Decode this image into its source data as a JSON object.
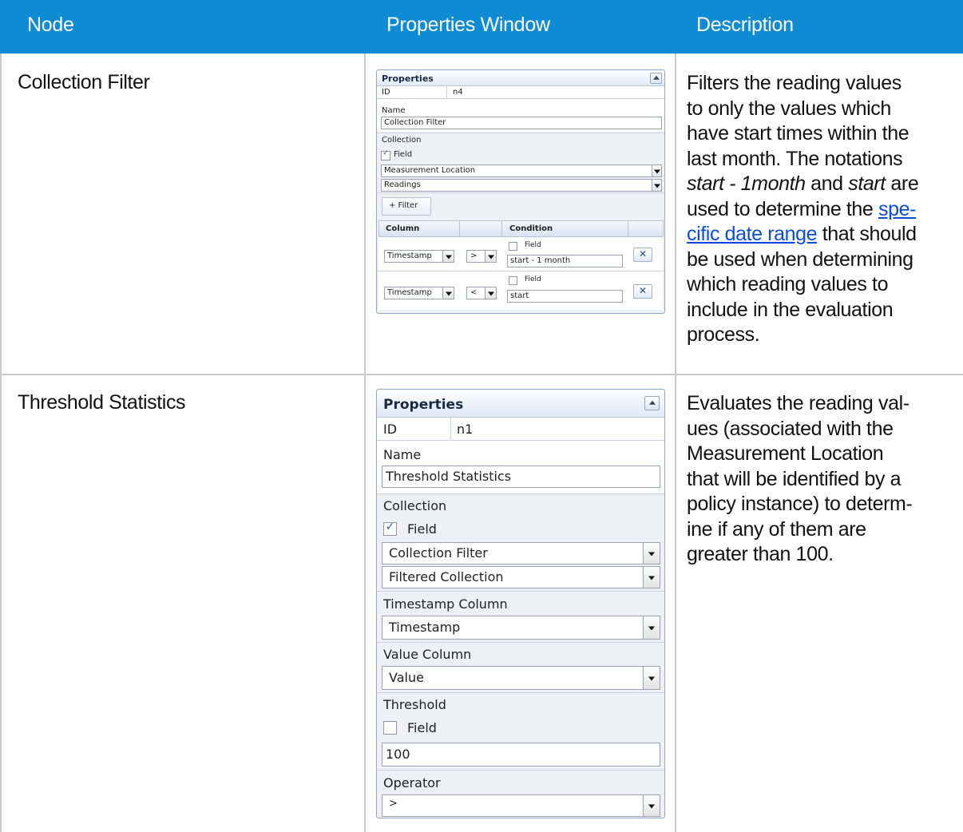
{
  "table": {
    "headers": {
      "node": "Node",
      "properties_window": "Properties Window",
      "description": "Description"
    },
    "header_bg": "#0f8bd4",
    "link_color": "#0a4dd8"
  },
  "row1": {
    "node": "Collection Filter",
    "desc": {
      "l1": "Filters the reading values",
      "l2": "to only the values which",
      "l3": "have start times within the",
      "l4": "last month. The notations",
      "l5_em1": "start - 1month",
      "l5_mid": " and ",
      "l5_em2": "start",
      "l5_end": " are",
      "l6_pre": "used to determine the ",
      "l6_link": "spe-",
      "l7_link": "cific date range",
      "l7_end": " that should",
      "l8": "be used when determining",
      "l9": "which reading values to",
      "l10": "include in the evaluation",
      "l11": "process."
    },
    "panel": {
      "title": "Properties",
      "id_label": "ID",
      "id_value": "n4",
      "name_label": "Name",
      "name_value": "Collection Filter",
      "collection_label": "Collection",
      "field_checkbox_label": "Field",
      "field_checked": true,
      "collection_select_1": "Measurement Location",
      "collection_select_2": "Readings",
      "filter_button": "+ Filter",
      "grid_col_column": "Column",
      "grid_col_condition": "Condition",
      "filters": [
        {
          "column": "Timestamp",
          "operator": ">",
          "field_label": "Field",
          "field_checked": false,
          "value": "start - 1 month"
        },
        {
          "column": "Timestamp",
          "operator": "<",
          "field_label": "Field",
          "field_checked": false,
          "value": "start"
        }
      ]
    }
  },
  "row2": {
    "node": "Threshold Statistics",
    "desc": {
      "l1": "Evaluates the reading val-",
      "l2": "ues (associated with the",
      "l3": "Measurement Location",
      "l4": "that will be identified by a",
      "l5": "policy instance) to determ-",
      "l6": "ine if any of them are",
      "l7": "greater than 100."
    },
    "panel": {
      "title": "Properties",
      "id_label": "ID",
      "id_value": "n1",
      "name_label": "Name",
      "name_value": "Threshold Statistics",
      "collection_label": "Collection",
      "field_checkbox_label": "Field",
      "field_checked": true,
      "collection_select_1": "Collection Filter",
      "collection_select_2": "Filtered Collection",
      "timestamp_label": "Timestamp Column",
      "timestamp_value": "Timestamp",
      "value_column_label": "Value Column",
      "value_column_value": "Value",
      "threshold_label": "Threshold",
      "threshold_field_label": "Field",
      "threshold_field_checked": false,
      "threshold_value": "100",
      "operator_label": "Operator",
      "operator_value": ">"
    }
  }
}
